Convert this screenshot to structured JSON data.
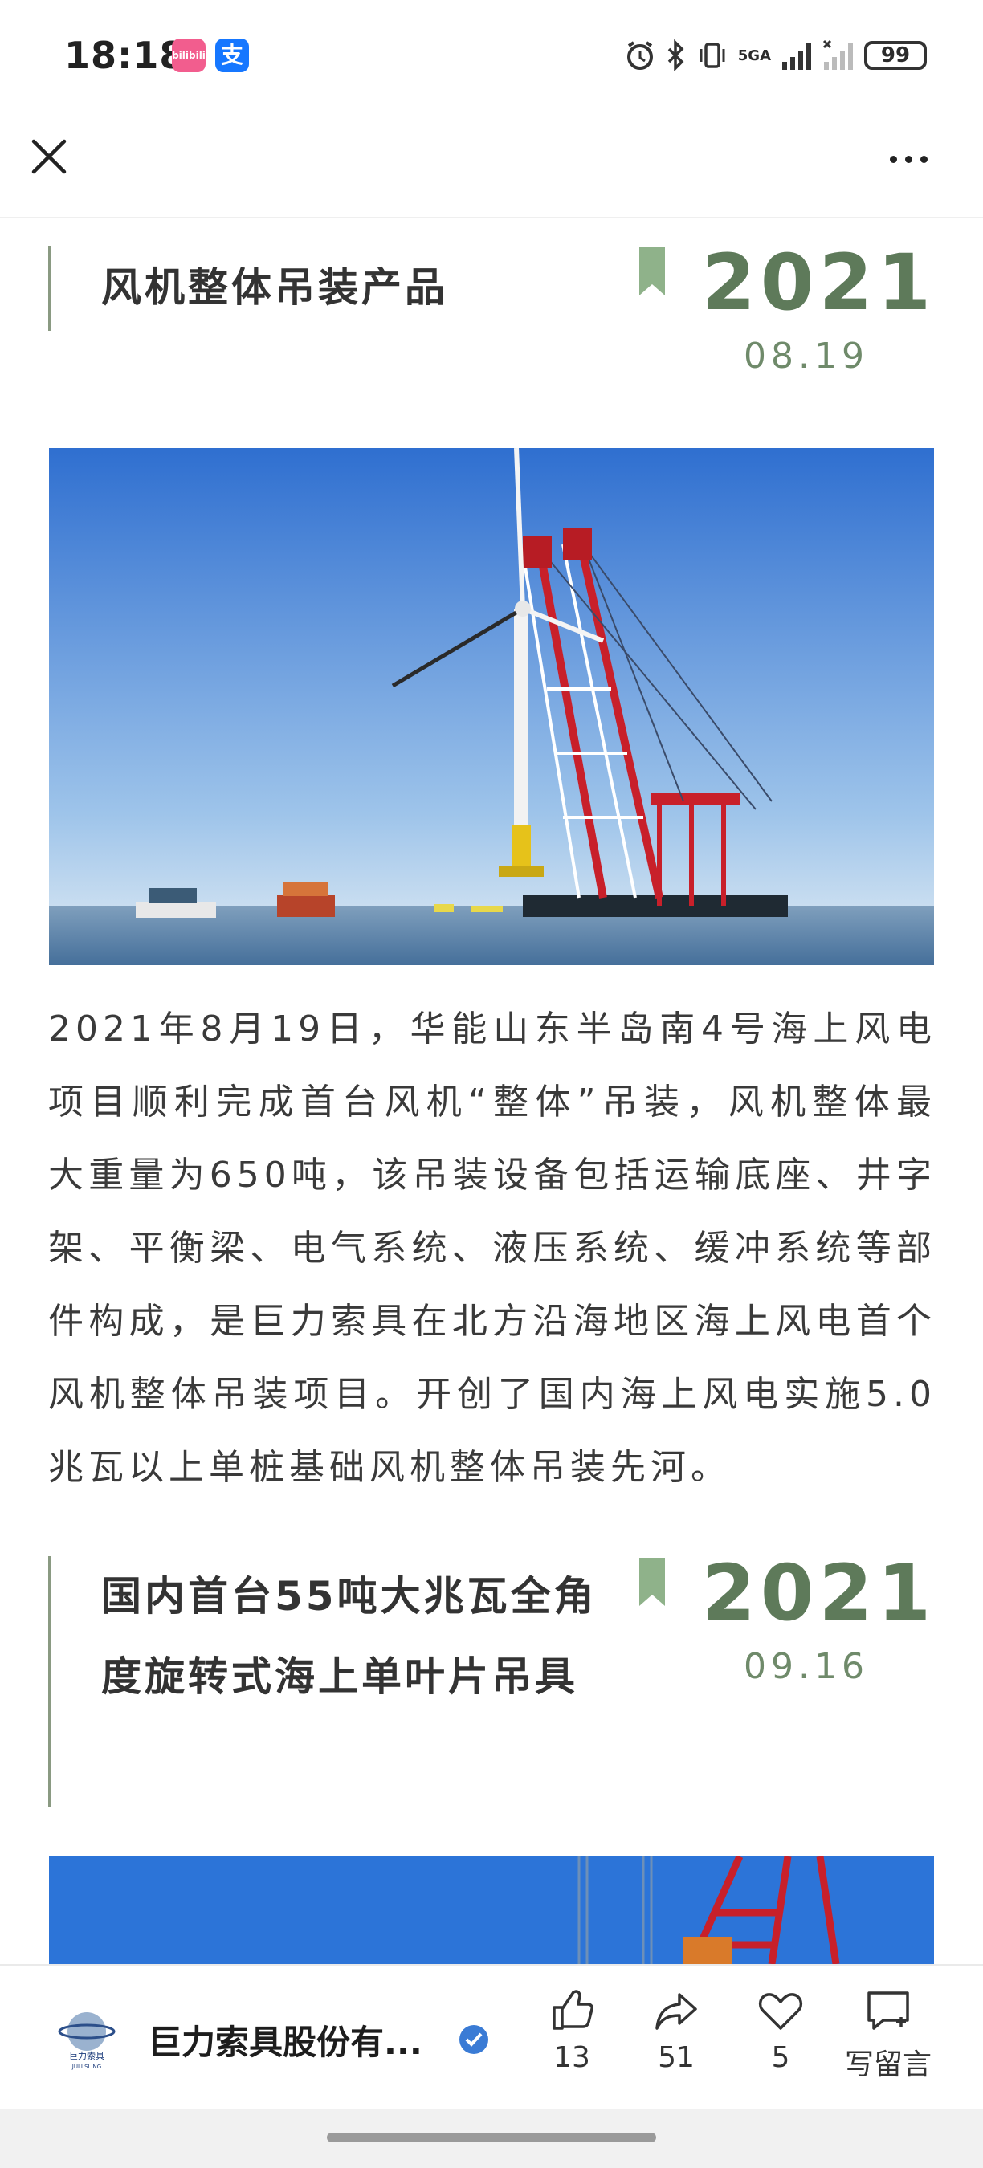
{
  "status_bar": {
    "time": "18:18",
    "app_badges": [
      "bilibili",
      "支"
    ],
    "network": "5GA",
    "battery": "99"
  },
  "nav": {
    "close_icon": "close-icon",
    "more_icon": "more-icon"
  },
  "article": {
    "sections": [
      {
        "title": "风机整体吊装产品",
        "year": "2021",
        "date": "08.19",
        "body": "2021年8月19日，华能山东半岛南4号海上风电项目顺利完成首台风机“整体”吊装，风机整体最大重量为650吨，该吊装设备包括运输底座、井字架、平衡梁、电气系统、液压系统、缓冲系统等部件构成，是巨力索具在北方沿海地区海上风电首个风机整体吊装项目。开创了国内海上风电实施5.0兆瓦以上单桩基础风机整体吊装先河。"
      },
      {
        "title": "国内首台55吨大兆瓦全角度旋转式海上单叶片吊具",
        "year": "2021",
        "date": "09.16"
      }
    ],
    "accent_color": "#5e7a5a"
  },
  "toolbar": {
    "account_name": "巨力索具股份有...",
    "logo_text": "巨力索具",
    "logo_sub": "JULI SLING",
    "like_count": "13",
    "share_count": "51",
    "favorite_count": "5",
    "comment_label": "写留言"
  }
}
